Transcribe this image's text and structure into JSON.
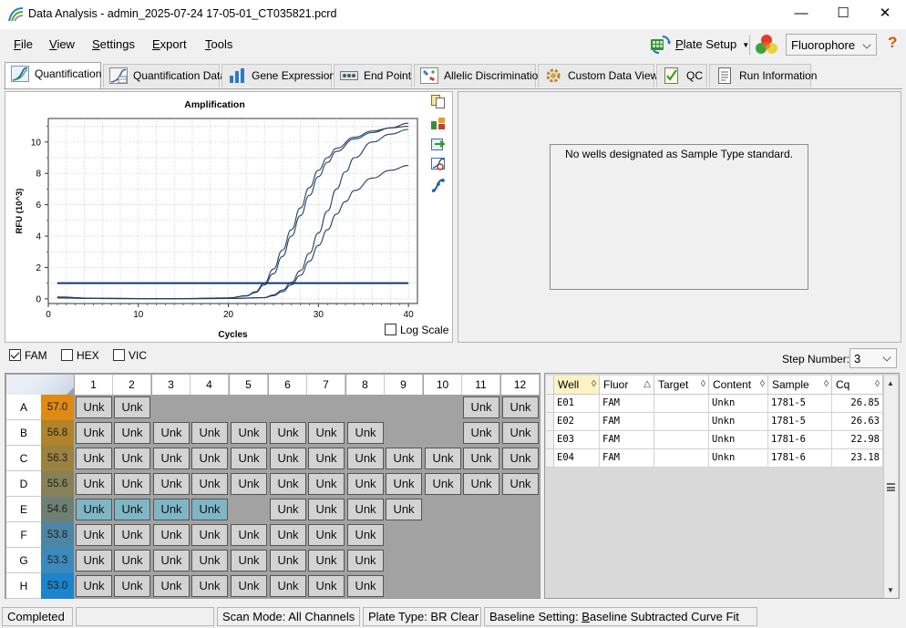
{
  "window": {
    "title": "Data Analysis - admin_2025-07-24 17-05-01_CT035821.pcrd",
    "minimize": "—",
    "maximize": "☐",
    "close": "✕"
  },
  "menu": {
    "file": {
      "accel": "F",
      "rest": "ile"
    },
    "view": {
      "accel": "V",
      "rest": "iew"
    },
    "settings": {
      "accel": "S",
      "rest": "ettings"
    },
    "export": {
      "accel": "E",
      "rest": "xport"
    },
    "tools": {
      "accel": "T",
      "rest": "ools"
    }
  },
  "toolbar": {
    "plate_setup_accel": "P",
    "plate_setup_rest": "late Setup",
    "fluorophore": "Fluorophore",
    "help": "?"
  },
  "tabs": [
    {
      "label": "Quantification",
      "active": true
    },
    {
      "label": "Quantification Data"
    },
    {
      "label": "Gene Expression"
    },
    {
      "label": "End Point"
    },
    {
      "label": "Allelic Discrimination"
    },
    {
      "label": "Custom Data View"
    },
    {
      "label": "QC"
    },
    {
      "label": "Run Information"
    }
  ],
  "chart_data": {
    "type": "line",
    "title": "Amplification",
    "xlabel": "Cycles",
    "ylabel": "RFU (10^3)",
    "xlim": [
      0,
      41
    ],
    "ylim": [
      -0.3,
      11.5
    ],
    "xticks": [
      0,
      10,
      20,
      30,
      40
    ],
    "yticks": [
      0,
      2,
      4,
      6,
      8,
      10
    ],
    "log_scale": false,
    "threshold": 1.0,
    "colors": {
      "series": "#1f3f66",
      "threshold": "#0c3b6e"
    },
    "series": [
      {
        "values": [
          [
            1,
            0.12
          ],
          [
            5,
            0.04
          ],
          [
            10,
            0.02
          ],
          [
            15,
            0.02
          ],
          [
            20,
            0.06
          ],
          [
            22,
            0.2
          ],
          [
            23,
            0.45
          ],
          [
            24,
            1.0
          ],
          [
            25,
            1.9
          ],
          [
            26,
            3.1
          ],
          [
            27,
            4.4
          ],
          [
            28,
            5.8
          ],
          [
            29,
            7.1
          ],
          [
            30,
            8.2
          ],
          [
            31,
            9.0
          ],
          [
            32,
            9.6
          ],
          [
            34,
            10.3
          ],
          [
            36,
            10.7
          ],
          [
            38,
            10.9
          ],
          [
            40,
            11.0
          ]
        ]
      },
      {
        "values": [
          [
            1,
            0.1
          ],
          [
            5,
            0.03
          ],
          [
            10,
            0.02
          ],
          [
            15,
            0.02
          ],
          [
            20,
            0.05
          ],
          [
            22,
            0.18
          ],
          [
            23,
            0.4
          ],
          [
            24,
            0.9
          ],
          [
            25,
            1.6
          ],
          [
            26,
            2.7
          ],
          [
            27,
            4.0
          ],
          [
            28,
            5.3
          ],
          [
            29,
            6.6
          ],
          [
            30,
            7.8
          ],
          [
            31,
            8.7
          ],
          [
            32,
            9.4
          ],
          [
            34,
            10.2
          ],
          [
            36,
            10.6
          ],
          [
            38,
            10.9
          ],
          [
            40,
            11.2
          ]
        ]
      },
      {
        "values": [
          [
            1,
            0.08
          ],
          [
            5,
            0.02
          ],
          [
            10,
            0.01
          ],
          [
            15,
            0.01
          ],
          [
            20,
            0.02
          ],
          [
            24,
            0.08
          ],
          [
            25,
            0.25
          ],
          [
            26,
            0.55
          ],
          [
            27,
            1.05
          ],
          [
            28,
            1.8
          ],
          [
            29,
            2.9
          ],
          [
            30,
            4.2
          ],
          [
            31,
            5.6
          ],
          [
            32,
            7.0
          ],
          [
            33,
            8.1
          ],
          [
            34,
            9.0
          ],
          [
            36,
            10.0
          ],
          [
            38,
            10.5
          ],
          [
            40,
            10.8
          ]
        ]
      },
      {
        "values": [
          [
            1,
            0.06
          ],
          [
            5,
            0.02
          ],
          [
            10,
            0.01
          ],
          [
            15,
            0.01
          ],
          [
            20,
            0.02
          ],
          [
            24,
            0.07
          ],
          [
            25,
            0.2
          ],
          [
            26,
            0.45
          ],
          [
            27,
            0.9
          ],
          [
            28,
            1.5
          ],
          [
            29,
            2.4
          ],
          [
            30,
            3.4
          ],
          [
            31,
            4.4
          ],
          [
            32,
            5.4
          ],
          [
            33,
            6.2
          ],
          [
            34,
            6.9
          ],
          [
            36,
            7.7
          ],
          [
            38,
            8.2
          ],
          [
            40,
            8.5
          ]
        ]
      }
    ]
  },
  "log_scale_label": "Log Scale",
  "std_message": "No wells designated as Sample Type standard.",
  "fluors": [
    {
      "label": "FAM",
      "checked": true
    },
    {
      "label": "HEX",
      "checked": false
    },
    {
      "label": "VIC",
      "checked": false
    }
  ],
  "step": {
    "label": "Step Number:",
    "value": "3"
  },
  "plate": {
    "columns": [
      "1",
      "2",
      "3",
      "4",
      "5",
      "6",
      "7",
      "8",
      "9",
      "10",
      "11",
      "12"
    ],
    "rows": [
      {
        "label": "A",
        "temp": "57.0",
        "color": "#df8a12",
        "wells": [
          "Unk",
          "Unk",
          "",
          "",
          "",
          "",
          "",
          "",
          "",
          "",
          "Unk",
          "Unk"
        ]
      },
      {
        "label": "B",
        "temp": "56.8",
        "color": "#b0842a",
        "wells": [
          "Unk",
          "Unk",
          "Unk",
          "Unk",
          "Unk",
          "Unk",
          "Unk",
          "Unk",
          "",
          "",
          "Unk",
          "Unk"
        ]
      },
      {
        "label": "C",
        "temp": "56.3",
        "color": "#9a8240",
        "wells": [
          "Unk",
          "Unk",
          "Unk",
          "Unk",
          "Unk",
          "Unk",
          "Unk",
          "Unk",
          "Unk",
          "Unk",
          "Unk",
          "Unk"
        ]
      },
      {
        "label": "D",
        "temp": "55.6",
        "color": "#87815a",
        "wells": [
          "Unk",
          "Unk",
          "Unk",
          "Unk",
          "Unk",
          "Unk",
          "Unk",
          "Unk",
          "Unk",
          "Unk",
          "Unk",
          "Unk"
        ]
      },
      {
        "label": "E",
        "temp": "54.6",
        "color": "#6e7f74",
        "wells": [
          "Unk",
          "Unk",
          "Unk",
          "Unk",
          "",
          "Unk",
          "Unk",
          "Unk",
          "Unk",
          "",
          "",
          ""
        ],
        "selected": [
          0,
          1,
          2,
          3
        ]
      },
      {
        "label": "F",
        "temp": "53.8",
        "color": "#4d86a4",
        "wells": [
          "Unk",
          "Unk",
          "Unk",
          "Unk",
          "Unk",
          "Unk",
          "Unk",
          "Unk",
          "",
          "",
          "",
          ""
        ]
      },
      {
        "label": "G",
        "temp": "53.3",
        "color": "#3c89bd",
        "wells": [
          "Unk",
          "Unk",
          "Unk",
          "Unk",
          "Unk",
          "Unk",
          "Unk",
          "Unk",
          "",
          "",
          "",
          ""
        ]
      },
      {
        "label": "H",
        "temp": "53.0",
        "color": "#1b84cc",
        "wells": [
          "Unk",
          "Unk",
          "Unk",
          "Unk",
          "Unk",
          "Unk",
          "Unk",
          "Unk",
          "",
          "",
          "",
          ""
        ]
      }
    ]
  },
  "table": {
    "headers": [
      "Well",
      "Fluor",
      "Target",
      "Content",
      "Sample",
      "Cq"
    ],
    "rows": [
      [
        "E01",
        "FAM",
        "",
        "Unkn",
        "1781-5",
        "26.85"
      ],
      [
        "E02",
        "FAM",
        "",
        "Unkn",
        "1781-5",
        "26.63"
      ],
      [
        "E03",
        "FAM",
        "",
        "Unkn",
        "1781-6",
        "22.98"
      ],
      [
        "E04",
        "FAM",
        "",
        "Unkn",
        "1781-6",
        "23.18"
      ]
    ]
  },
  "status": {
    "state": "Completed",
    "scan_mode": "Scan Mode: All Channels",
    "plate_type": "Plate Type: BR Clear",
    "baseline_prefix": "Baseline Setting: ",
    "baseline_accel": "B",
    "baseline_rest": "aseline Subtracted Curve Fit"
  }
}
